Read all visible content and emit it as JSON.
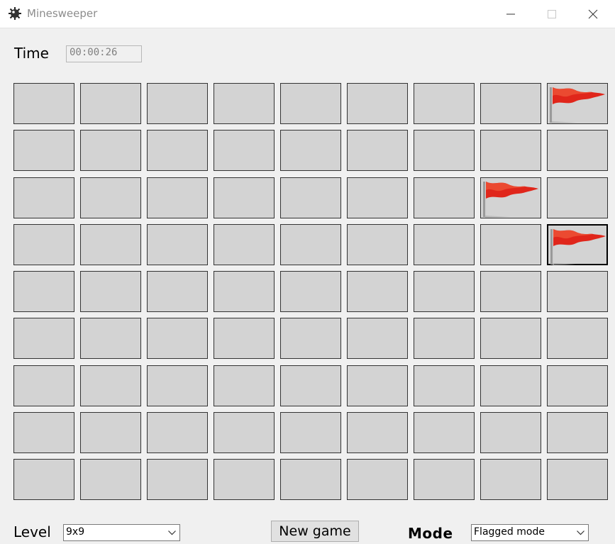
{
  "window": {
    "title": "Minesweeper",
    "app_icon": "mine-icon",
    "controls": [
      "minimize-icon",
      "maximize-icon",
      "close-icon"
    ]
  },
  "timer": {
    "label": "Time",
    "value": "00:00:26"
  },
  "board": {
    "rows": 9,
    "cols": 9,
    "cell_color": "#d3d3d3",
    "flag_color": "#e0261b",
    "flagged": [
      [
        0,
        8
      ],
      [
        2,
        7
      ],
      [
        3,
        8
      ]
    ],
    "selected": [
      3,
      8
    ]
  },
  "footer": {
    "level_label": "Level",
    "level_value": "9x9",
    "new_game_label": "New game",
    "mode_label": "Mode",
    "mode_value": "Flagged mode"
  }
}
